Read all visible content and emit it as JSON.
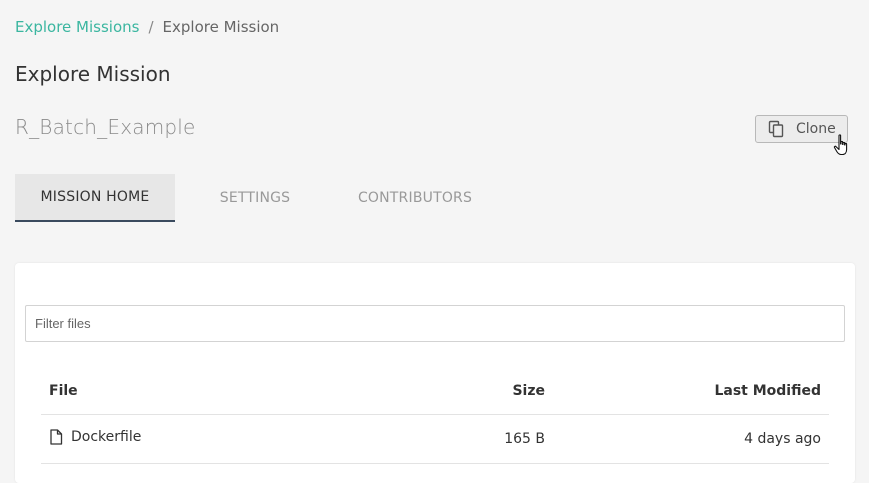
{
  "breadcrumb": {
    "parent": "Explore Missions",
    "separator": "/",
    "current": "Explore Mission"
  },
  "page": {
    "title": "Explore Mission",
    "mission_name": "R_Batch_Example"
  },
  "actions": {
    "clone_label": "Clone",
    "clone_icon": "copy-icon"
  },
  "tabs": [
    {
      "label": "MISSION HOME",
      "active": true
    },
    {
      "label": "SETTINGS",
      "active": false
    },
    {
      "label": "CONTRIBUTORS",
      "active": false
    }
  ],
  "files": {
    "filter_placeholder": "Filter files",
    "filter_value": "",
    "columns": {
      "file": "File",
      "size": "Size",
      "modified": "Last Modified"
    },
    "rows": [
      {
        "icon": "file-icon",
        "name": "Dockerfile",
        "size": "165 B",
        "modified": "4 days ago"
      }
    ]
  },
  "colors": {
    "accent": "#3bb6a0",
    "tab_indicator": "#3a4a5e",
    "background": "#f5f5f5"
  }
}
